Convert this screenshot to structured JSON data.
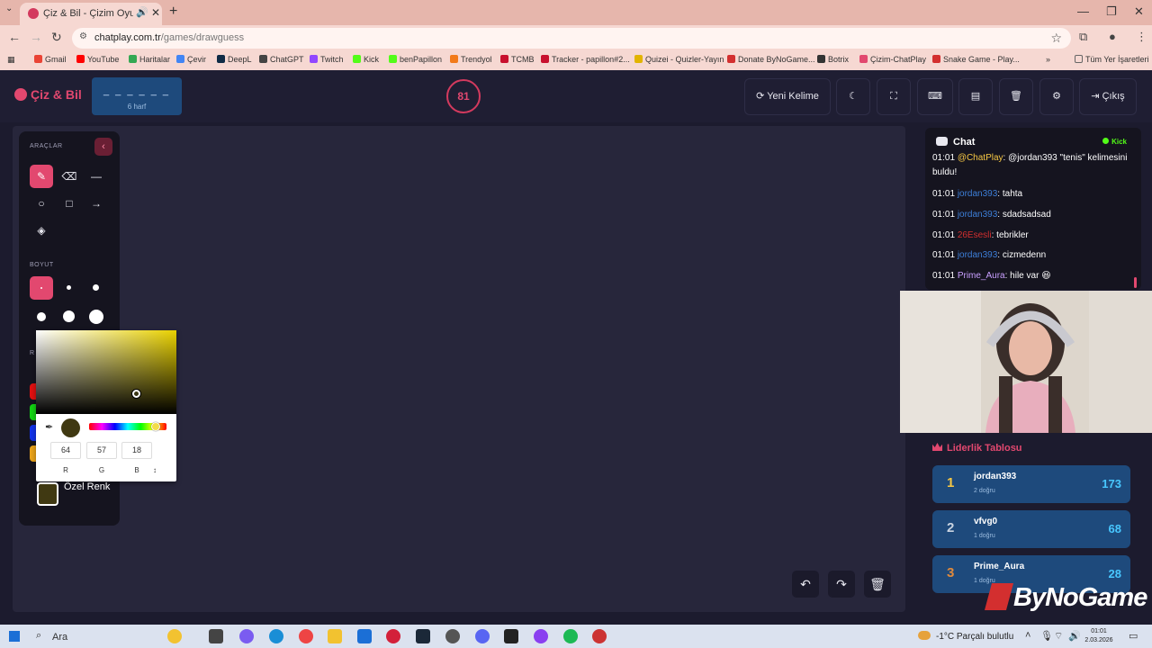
{
  "browser": {
    "tab_title": "Çiz & Bil - Çizim Oyunu",
    "new_tab_symbol": "+",
    "url_domain": "chatplay.com.tr",
    "url_path": "/games/drawguess",
    "bookmarks": [
      {
        "label": "Gmail",
        "color": "#ea4335"
      },
      {
        "label": "YouTube",
        "color": "#ff0000"
      },
      {
        "label": "Haritalar",
        "color": "#34a853"
      },
      {
        "label": "Çevir",
        "color": "#4285f4"
      },
      {
        "label": "DeepL",
        "color": "#0f2b46"
      },
      {
        "label": "ChatGPT",
        "color": "#444444"
      },
      {
        "label": "Twitch",
        "color": "#9146ff"
      },
      {
        "label": "Kick",
        "color": "#53fc18"
      },
      {
        "label": "benPapillon",
        "color": "#53fc18"
      },
      {
        "label": "Trendyol",
        "color": "#f27a1a"
      },
      {
        "label": "TCMB",
        "color": "#c8102e"
      },
      {
        "label": "Tracker - papillon#2...",
        "color": "#c8102e"
      },
      {
        "label": "Quizei - Quizler-Yayın",
        "color": "#e2b400"
      },
      {
        "label": "Donate ByNoGame...",
        "color": "#d32f2f"
      },
      {
        "label": "Botrix",
        "color": "#333333"
      },
      {
        "label": "Çizim-ChatPlay",
        "color": "#e2486f"
      },
      {
        "label": "Snake Game - Play...",
        "color": "#d32f2f"
      }
    ],
    "all_bookmarks_label": "Tüm Yer İşaretleri"
  },
  "header": {
    "logo_text": "Çiz & Bil",
    "word_mask": "_ _ _ _ _ _",
    "word_length": "6 harf",
    "timer": "81",
    "new_word_label": "Yeni Kelime",
    "exit_label": "Çıkış"
  },
  "tools": {
    "section_tools": "ARAÇLAR",
    "section_size": "BOYUT",
    "section_colors_partial": "R",
    "custom_color_label": "Özel Renk",
    "custom_color": "#403912"
  },
  "picker": {
    "r": "64",
    "g": "57",
    "b": "18",
    "label_r": "R",
    "label_g": "G",
    "label_b": "B",
    "toggle_symbol": "↕",
    "hue_color": "#e9d100"
  },
  "chat": {
    "title": "Chat",
    "platform": "Kick",
    "messages": [
      {
        "time": "01:01",
        "user": "@ChatPlay",
        "text": ": @jordan393 \"tenis\" kelimesini buldu!",
        "color": "#f6c744"
      },
      {
        "time": "01:01",
        "user": "jordan393",
        "text": ": tahta",
        "color": "#3d7fd9"
      },
      {
        "time": "01:01",
        "user": "jordan393",
        "text": ": sdadsadsad",
        "color": "#3d7fd9"
      },
      {
        "time": "01:01",
        "user": "26Esesli",
        "text": ": tebrikler",
        "color": "#d32f2f"
      },
      {
        "time": "01:01",
        "user": "jordan393",
        "text": ": cizmedenn",
        "color": "#3d7fd9"
      },
      {
        "time": "01:01",
        "user": "Prime_Aura",
        "text": ": hile var 😆",
        "color": "#c9a0ff"
      }
    ]
  },
  "leaderboard": {
    "title": "Liderlik Tablosu",
    "rows": [
      {
        "rank": "1",
        "name": "jordan393",
        "sub": "2 doğru",
        "score": "173",
        "rank_color": "#f6c744"
      },
      {
        "rank": "2",
        "name": "vfvg0",
        "sub": "1 doğru",
        "score": "68",
        "rank_color": "#c9d3e0"
      },
      {
        "rank": "3",
        "name": "Prime_Aura",
        "sub": "1 doğru",
        "score": "28",
        "rank_color": "#e08a3c"
      }
    ]
  },
  "overlay": {
    "brand": "ByNoGame"
  },
  "taskbar": {
    "search_label": "Ara",
    "weather": "-1°C  Parçalı bulutlu",
    "time": "01:01",
    "date": "2.03.2026"
  }
}
